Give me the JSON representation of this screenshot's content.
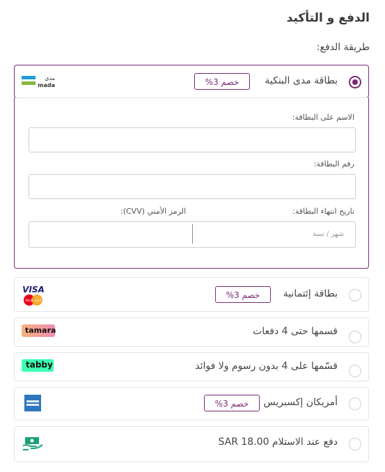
{
  "header": {
    "title": "الدفع و التأكيد",
    "subtitle": "طريقة الدفع:"
  },
  "payment_methods": [
    {
      "label": "بطاقة مدى البنكية",
      "badge": "خصم 3%",
      "logo": "mada-logo",
      "selected": true
    },
    {
      "label": "بطاقة إئتمانية",
      "badge": "خصم 3%",
      "logo": "visa-mastercard-logo",
      "selected": false
    },
    {
      "label": "قسمها حتى 4 دفعات",
      "badge": "",
      "logo": "tamara-logo",
      "selected": false
    },
    {
      "label": "قسّمها على 4 بدون رسوم ولا فوائد",
      "badge": "",
      "logo": "tabby-logo",
      "selected": false
    },
    {
      "label": "أمريكان إكسبريس",
      "badge": "خصم 3%",
      "logo": "amex-logo",
      "selected": false
    },
    {
      "label": "دفع عند الاستلام SAR 18.00",
      "badge": "",
      "logo": "cash-on-delivery-icon",
      "selected": false
    }
  ],
  "logos": {
    "mada": {
      "top": "مدى",
      "bottom": "mada"
    },
    "visa": "VISA",
    "mastercard": "MasterCard",
    "tamara": "tamara",
    "tabby": "tabby"
  },
  "card_form": {
    "name_label": "الاسم على البطاقة:",
    "name_value": "",
    "number_label": "رقم البطاقة:",
    "number_value": "",
    "expiry_label": "تاريخ انتهاء البطاقة:",
    "expiry_placeholder": "شهر / سنة",
    "cvv_label": "الرمز الأمني (CVV):"
  },
  "colors": {
    "accent": "#7b2a74",
    "mada_green": "#84b740",
    "mada_blue": "#259bd6",
    "tamara": "#f29d6f",
    "tabby": "#3bffb1",
    "amex": "#2e77bc"
  }
}
